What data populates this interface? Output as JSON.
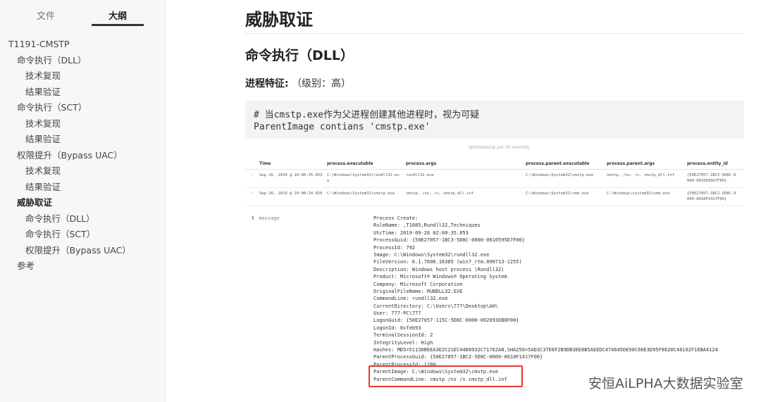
{
  "sidebar": {
    "tabs": {
      "file": "文件",
      "outline": "大纲"
    },
    "outline": [
      {
        "label": "T1191-CMSTP",
        "level": 0,
        "active": false
      },
      {
        "label": "命令执行（DLL）",
        "level": 1,
        "active": false
      },
      {
        "label": "技术复现",
        "level": 2,
        "active": false
      },
      {
        "label": "结果验证",
        "level": 2,
        "active": false
      },
      {
        "label": "命令执行（SCT）",
        "level": 1,
        "active": false
      },
      {
        "label": "技术复现",
        "level": 2,
        "active": false
      },
      {
        "label": "结果验证",
        "level": 2,
        "active": false
      },
      {
        "label": "权限提升（Bypass UAC）",
        "level": 1,
        "active": false
      },
      {
        "label": "技术复现",
        "level": 2,
        "active": false
      },
      {
        "label": "结果验证",
        "level": 2,
        "active": false
      },
      {
        "label": "威胁取证",
        "level": 1,
        "active": true
      },
      {
        "label": "命令执行（DLL）",
        "level": 2,
        "active": false
      },
      {
        "label": "命令执行（SCT）",
        "level": 2,
        "active": false
      },
      {
        "label": "权限提升（Bypass UAC）",
        "level": 2,
        "active": false
      },
      {
        "label": "参考",
        "level": 1,
        "active": false
      }
    ]
  },
  "main": {
    "h1": "威胁取证",
    "h2": "命令执行（DLL）",
    "para_bold": "进程特征:",
    "para_rest": "（级别：高）",
    "code": [
      "# 当cmstp.exe作为父进程创建其他进程时，视为可疑",
      "ParentImage contians 'cmstp.exe'"
    ]
  },
  "screenshot": {
    "top_text": "@timestamp per 30 seconds",
    "headers": [
      "Time",
      "process.executable",
      "process.args",
      "process.parent.executable",
      "process.parent.args",
      "process.entity_id"
    ],
    "rows": [
      {
        "expand": "›",
        "time": "Sep 26, 2019 @ 10:00:35.053",
        "executable": "C:\\Windows\\System32\\rundll32.ex\ne",
        "args": "rundll32.exe",
        "parent_executable": "C:\\Windows\\System32\\cmstp.exe",
        "parent_args": "cmstp, /ns, /s, cmstp_dll.inf",
        "entity_id": "{50E27057-1BC3-5D8C-0\n000-0010595D7F00}"
      },
      {
        "expand": "›",
        "time": "Sep 26, 2019 @ 10:00:34.650",
        "executable": "C:\\Windows\\System32\\cmstp.exe",
        "args": "cmstp, /ns, /s, cmstp_dll.inf",
        "parent_executable": "C:\\Windows\\System32\\cmd.exe",
        "parent_args": "C:\\Windows\\system32\\cmd.exe",
        "entity_id": "{50E27057-1BC2-5D8C-0\n000-0010F1417F00}"
      }
    ],
    "message_type": "t",
    "message_label": "message",
    "message_lines": [
      "Process Create:",
      "RuleName: ,T1085,Rundll32,Techniques",
      "UtcTime: 2019-09-26 02:00:35.053",
      "ProcessGuid: {50E27057-1BC3-5D8C-0000-0010595D7F00}",
      "ProcessId: 792",
      "Image: C:\\Windows\\System32\\rundll32.exe",
      "FileVersion: 6.1.7600.16385 (win7_rtm.090713-1255)",
      "Description: Windows host process (Rundll32)",
      "Product: Microsoft® Windows® Operating System",
      "Company: Microsoft Corporation",
      "OriginalFileName: RUNDLL32.EXE",
      "CommandLine: rundll32.exe",
      "CurrentDirectory: C:\\Users\\777\\Desktop\\AH\\",
      "User: 777-PC\\777",
      "LogonGuid: {50E27057-115C-5D8C-0000-002093EB0F00}",
      "LogonId: 0xfeb93",
      "TerminalSessionId: 2",
      "IntegrityLevel: High",
      "Hashes: MD5=51138BEEA3E2C21EC44D0932C71762A8,SHA256=5AD3C37E6F2B9DB3EE8B5AEEDC474645DE90C66E3D95F8620C48102F1EBA4124",
      "ParentProcessGuid: {50E27057-1BC2-5D8C-0000-0010F1417F00}",
      "ParentProcessId: 1180",
      "ParentImage: C:\\Windows\\System32\\cmstp.exe",
      "ParentCommandLine: cmstp  /ns /s cmstp_dll.inf"
    ]
  },
  "watermark": "安恒AiLPHA大数据实验室",
  "colors": {
    "highlight": "#e53935",
    "sidebar_bg": "#f7f7f7",
    "code_bg": "#f3f3f3"
  }
}
